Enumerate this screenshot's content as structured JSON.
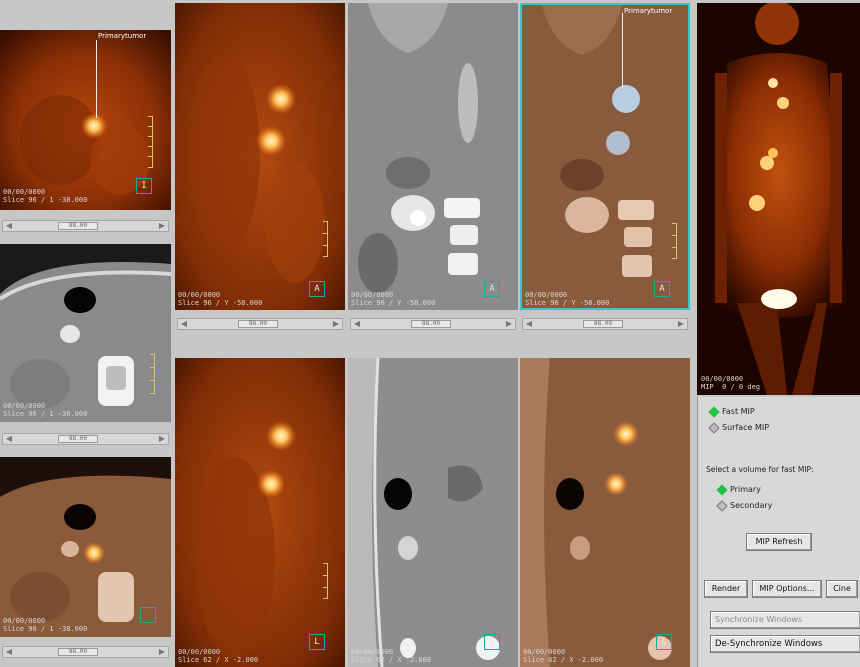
{
  "annotation": {
    "tumor_label": "Primarytumor"
  },
  "viewports": {
    "axial_pet": {
      "info": "00/00/0000\nSlice 96 / 1 -38.000",
      "orient": "I"
    },
    "axial_ct": {
      "info": "00/00/0000\nSlice 96 / 1 -38.000"
    },
    "axial_fused": {
      "info": "00/00/0000\nSlice 96 / 1 -38.000"
    },
    "coronal_pet": {
      "info": "00/00/0000\nSlice 96 / Y -58.000",
      "orient": "A"
    },
    "coronal_ct": {
      "info": "00/00/0000\nSlice 96 / Y -58.000",
      "orient": "A"
    },
    "coronal_fused": {
      "info": "00/00/0000\nSlice 96 / Y -58.000",
      "orient": "A"
    },
    "sagittal_pet": {
      "info": "00/00/0000\nSlice 62 / X -2.000",
      "orient": "L"
    },
    "sagittal_ct": {
      "info": "00/00/0000\nSlice 62 / X -2.000",
      "orient": "L"
    },
    "sagittal_fused": {
      "info": "00/00/0000\nSlice 62 / X -2.000",
      "orient": "L"
    },
    "mip": {
      "info": "00/00/0000\nMIP  0 / 0 deg"
    }
  },
  "scrollbars": {
    "thumb_label": "88.00"
  },
  "mip_panel": {
    "fast_mip_label": "Fast MIP",
    "surface_mip_label": "Surface MIP",
    "select_volume_text": "Select a volume for fast MIP:",
    "primary_label": "Primary",
    "secondary_label": "Secondary",
    "mip_refresh_label": "MIP Refresh",
    "render_label": "Render",
    "mip_options_label": "MIP Options...",
    "cine_label": "Cine",
    "sync_label": "Synchronize Windows",
    "desync_label": "De-Synchronize Windows"
  },
  "colors": {
    "radio_on": "#22c24a",
    "border_accent": "#35c7c7",
    "pet_hot": "#ffd27a"
  }
}
